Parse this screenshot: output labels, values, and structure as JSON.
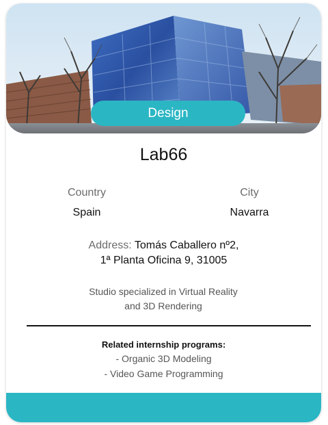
{
  "card": {
    "category": "Design",
    "name": "Lab66",
    "country": {
      "label": "Country",
      "value": "Spain"
    },
    "city": {
      "label": "City",
      "value": "Navarra"
    },
    "address": {
      "label": "Address:",
      "line1": "Tomás Caballero nº2,",
      "line2": "1ª Planta Oficina 9, 31005"
    },
    "description": {
      "line1": "Studio specialized in Virtual Reality",
      "line2": "and 3D Rendering"
    },
    "related": {
      "heading": "Related internship programs:",
      "programs": [
        "- Organic 3D Modeling",
        "- Video Game Programming"
      ]
    }
  },
  "colors": {
    "accent": "#2bb6c4",
    "text_primary": "#111111",
    "text_secondary": "#6b6b6b"
  }
}
